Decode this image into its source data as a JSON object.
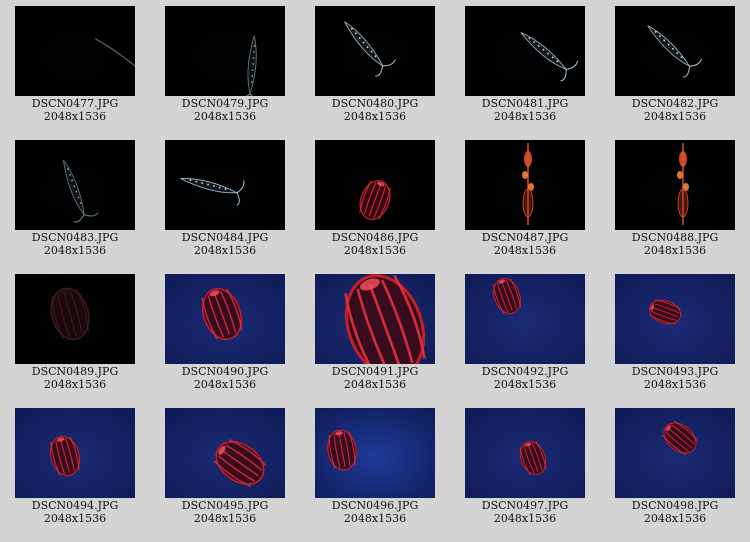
{
  "gallery": {
    "items": [
      {
        "filename": "DSCN0477.JPG",
        "dims": "2048x1536",
        "scene": "dark",
        "subject": "dim-streak"
      },
      {
        "filename": "DSCN0479.JPG",
        "dims": "2048x1536",
        "scene": "dark",
        "subject": "faint-comb-jelly"
      },
      {
        "filename": "DSCN0480.JPG",
        "dims": "2048x1536",
        "scene": "dark",
        "subject": "clear-comb-jelly"
      },
      {
        "filename": "DSCN0481.JPG",
        "dims": "2048x1536",
        "scene": "dark",
        "subject": "clear-comb-jelly"
      },
      {
        "filename": "DSCN0482.JPG",
        "dims": "2048x1536",
        "scene": "dark",
        "subject": "clear-comb-jelly"
      },
      {
        "filename": "DSCN0483.JPG",
        "dims": "2048x1536",
        "scene": "dark",
        "subject": "faint-comb-jelly"
      },
      {
        "filename": "DSCN0484.JPG",
        "dims": "2048x1536",
        "scene": "dark",
        "subject": "clear-comb-jelly"
      },
      {
        "filename": "DSCN0486.JPG",
        "dims": "2048x1536",
        "scene": "dark",
        "subject": "red-comb-jelly"
      },
      {
        "filename": "DSCN0487.JPG",
        "dims": "2048x1536",
        "scene": "dark",
        "subject": "orange-siphonophore"
      },
      {
        "filename": "DSCN0488.JPG",
        "dims": "2048x1536",
        "scene": "dark",
        "subject": "orange-siphonophore"
      },
      {
        "filename": "DSCN0489.JPG",
        "dims": "2048x1536",
        "scene": "dark",
        "subject": "dim-red-jelly"
      },
      {
        "filename": "DSCN0490.JPG",
        "dims": "2048x1536",
        "scene": "blue",
        "subject": "red-jelly"
      },
      {
        "filename": "DSCN0491.JPG",
        "dims": "2048x1536",
        "scene": "blue",
        "subject": "large-red-jelly"
      },
      {
        "filename": "DSCN0492.JPG",
        "dims": "2048x1536",
        "scene": "blue",
        "subject": "small-red-jelly"
      },
      {
        "filename": "DSCN0493.JPG",
        "dims": "2048x1536",
        "scene": "blue",
        "subject": "small-red-jelly"
      },
      {
        "filename": "DSCN0494.JPG",
        "dims": "2048x1536",
        "scene": "blue",
        "subject": "red-jelly"
      },
      {
        "filename": "DSCN0495.JPG",
        "dims": "2048x1536",
        "scene": "blue",
        "subject": "red-jelly"
      },
      {
        "filename": "DSCN0496.JPG",
        "dims": "2048x1536",
        "scene": "bright-blue",
        "subject": "red-jelly"
      },
      {
        "filename": "DSCN0497.JPG",
        "dims": "2048x1536",
        "scene": "blue",
        "subject": "small-red-jelly"
      },
      {
        "filename": "DSCN0498.JPG",
        "dims": "2048x1536",
        "scene": "blue",
        "subject": "small-red-jelly"
      }
    ]
  },
  "colors": {
    "page_background": "#d4d4d4",
    "caption_text": "#111111",
    "dark_scene": "#020204",
    "blue_scene": "#1b2a74",
    "bright_blue_scene": "#1f3a98",
    "jelly_red": "#c0202a",
    "siphonophore_orange": "#e0502a",
    "clear_jelly": "#b8d8e8"
  }
}
